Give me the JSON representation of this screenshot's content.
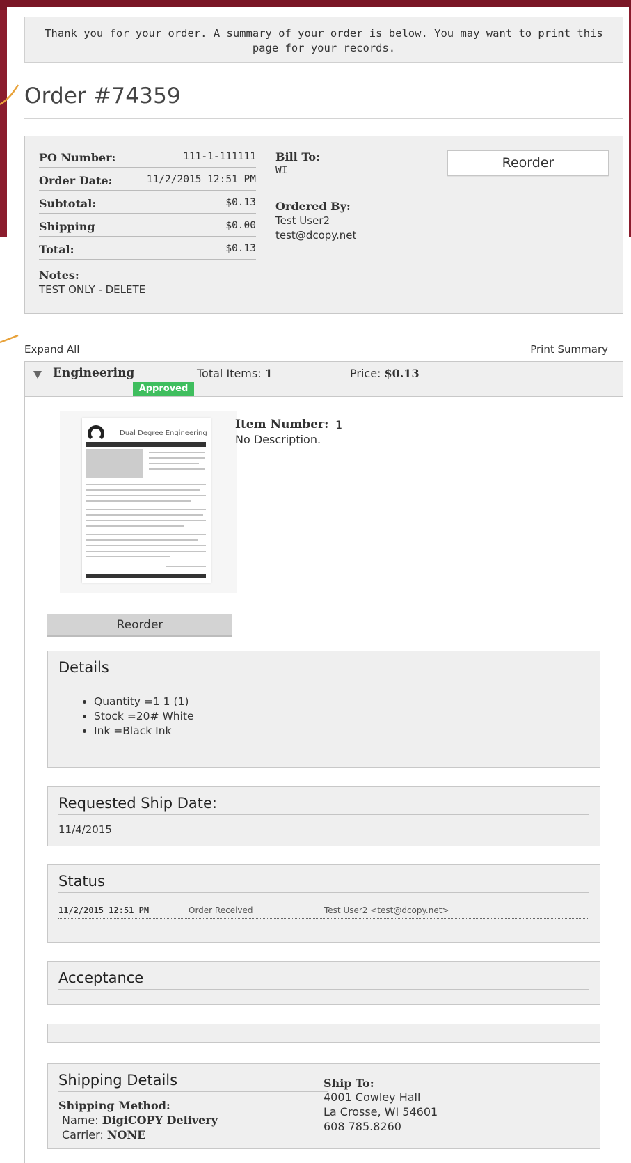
{
  "notice": {
    "line1": "Thank you for your order. A summary of your order is below. You may want to print this",
    "line2": "page for your records."
  },
  "order": {
    "title": "Order #74359",
    "po_label": "PO Number:",
    "po_value": "111-1-111111",
    "date_label": "Order Date:",
    "date_value": "11/2/2015 12:51 PM",
    "subtotal_label": "Subtotal:",
    "subtotal_value": "$0.13",
    "shipping_label": "Shipping",
    "shipping_value": "$0.00",
    "total_label": "Total:",
    "total_value": "$0.13",
    "notes_label": "Notes:",
    "notes_value": "TEST ONLY - DELETE",
    "bill_to_label": "Bill To:",
    "bill_to_value": "WI",
    "ordered_by_label": "Ordered By:",
    "ordered_by_name": "Test User2",
    "ordered_by_email": "test@dcopy.net",
    "reorder_label": "Reorder"
  },
  "links": {
    "expand_all": "Expand All",
    "print_summary": "Print Summary"
  },
  "group": {
    "name": "Engineering",
    "badge": "Approved",
    "total_items_label": "Total Items:",
    "total_items_value": "1",
    "price_label": "Price:",
    "price_value": "$0.13"
  },
  "item": {
    "thumbnail_title": "Dual Degree Engineering",
    "number_label": "Item Number:",
    "number_value": "1",
    "description": "No Description.",
    "reorder_label": "Reorder"
  },
  "details": {
    "title": "Details",
    "items": [
      "Quantity =1 1 (1)",
      "Stock =20# White",
      "Ink =Black Ink"
    ]
  },
  "ship_date": {
    "title": "Requested Ship Date:",
    "value": "11/4/2015"
  },
  "status": {
    "title": "Status",
    "entries": [
      {
        "date": "11/2/2015 12:51 PM",
        "event": "Order Received",
        "user": "Test User2 <test@dcopy.net>"
      }
    ]
  },
  "acceptance": {
    "title": "Acceptance"
  },
  "shipping_details": {
    "title": "Shipping Details",
    "method_label": "Shipping Method:",
    "name_label": "Name:",
    "name_value": "DigiCOPY Delivery",
    "carrier_label": "Carrier:",
    "carrier_value": "NONE",
    "ship_to_label": "Ship To:",
    "ship_to_line1": "4001 Cowley Hall",
    "ship_to_line2": "La Crosse, WI 54601",
    "ship_to_line3": "608 785.8260"
  },
  "colors": {
    "brand_maroon": "#8b1c2d",
    "approved_green": "#3fbe5e",
    "connector_orange": "#e8a23a"
  }
}
